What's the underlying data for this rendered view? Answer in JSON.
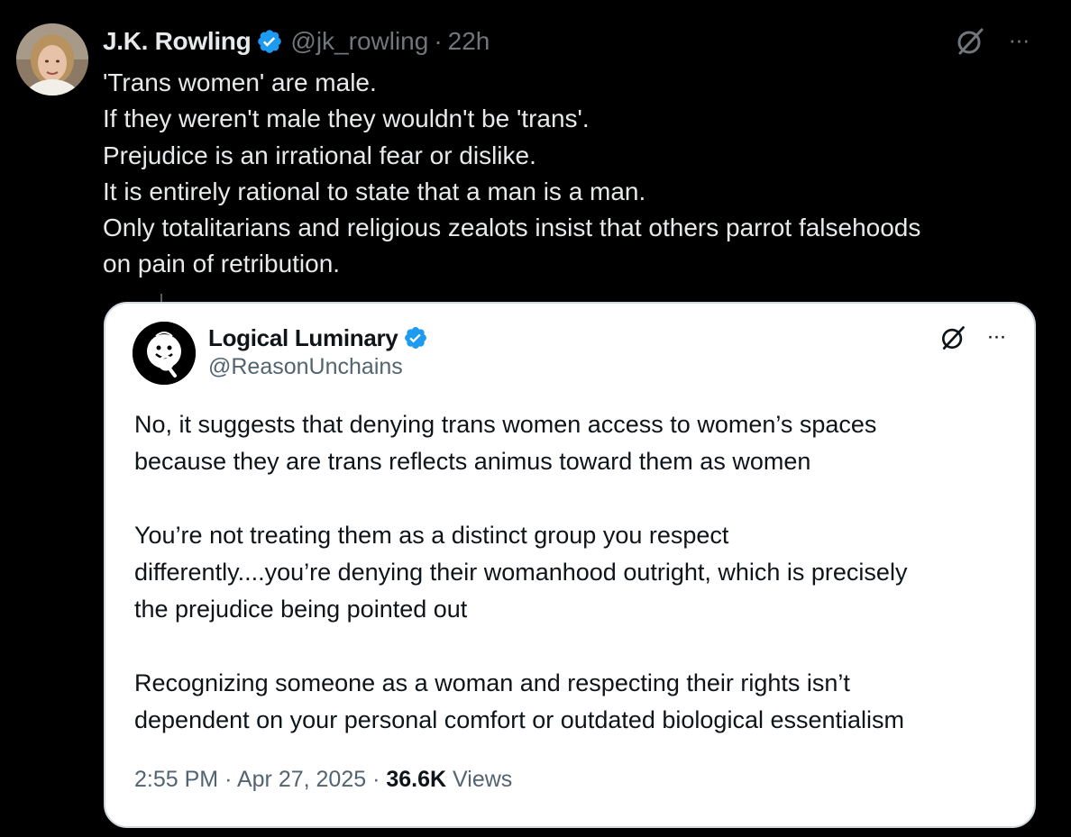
{
  "tweet": {
    "author": {
      "display_name": "J.K. Rowling",
      "handle": "@jk_rowling",
      "verified": true,
      "avatar_icon": "profile-photo"
    },
    "separator": "·",
    "time": "22h",
    "more_label": "···",
    "lines": [
      "'Trans women' are male.",
      "If they weren't male they wouldn't be 'trans'.",
      "Prejudice is an irrational fear or dislike.",
      "It is entirely rational to state that a man is a man.",
      "Only totalitarians and religious zealots insist that others parrot falsehoods",
      "on pain of retribution."
    ]
  },
  "quote": {
    "author": {
      "display_name": "Logical Luminary",
      "handle": "@ReasonUnchains",
      "verified": true,
      "avatar_icon": "smiley-magnifier-avatar"
    },
    "more_label": "···",
    "paragraphs": [
      [
        "No, it suggests that denying trans women access to women’s spaces",
        "because they are trans reflects animus toward them as women"
      ],
      [
        "You’re not treating them as a distinct group you respect",
        "differently....you’re denying their womanhood outright, which is precisely",
        "the prejudice being pointed out"
      ],
      [
        "Recognizing someone as a woman and respecting their rights isn’t",
        "dependent on your personal comfort or outdated biological essentialism"
      ]
    ],
    "meta": {
      "time": "2:55 PM",
      "separator": "·",
      "date": "Apr 27, 2025",
      "views_count": "36.6K",
      "views_label": "Views"
    }
  },
  "colors": {
    "background": "#000000",
    "primary_text_dark": "#e7e9ea",
    "secondary_text_dark": "#71767b",
    "verified_blue": "#1d9bf0",
    "card_background": "#ffffff",
    "card_border": "#cfd9de",
    "primary_text_light": "#0f1419",
    "secondary_text_light": "#536471"
  }
}
